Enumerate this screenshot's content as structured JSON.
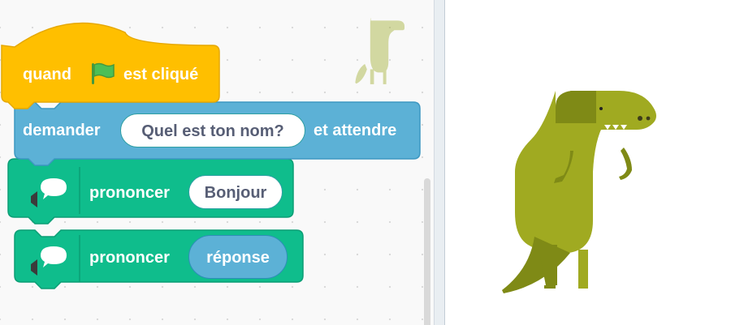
{
  "blocks": {
    "hat": {
      "prefix": "quand",
      "flag_icon": "green-flag-icon",
      "suffix": "est cliqué",
      "color": "#ffbf00"
    },
    "ask": {
      "label": "demander",
      "input": "Quel est ton nom?",
      "suffix": "et attendre",
      "color": "#5cb1d6"
    },
    "say1": {
      "icon": "speech-icon",
      "label": "prononcer",
      "input": "Bonjour",
      "color": "#0fbd8c"
    },
    "say2": {
      "icon": "speech-icon",
      "label": "prononcer",
      "reporter": "réponse",
      "color": "#0fbd8c"
    }
  },
  "sprite": {
    "name_icon": "dinosaur-icon",
    "color": "#a0aa21"
  }
}
